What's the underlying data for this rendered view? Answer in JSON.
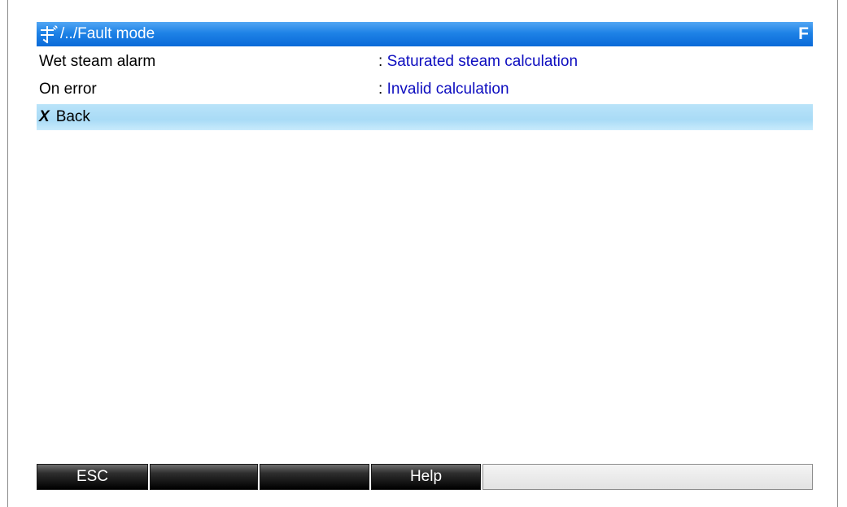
{
  "header": {
    "path": "/../Fault mode",
    "mode": "F",
    "icon": "setup-wrench-icon"
  },
  "rows": [
    {
      "label": "Wet steam alarm",
      "separator": ":",
      "value": "Saturated steam calculation"
    },
    {
      "label": "On error",
      "separator": ":",
      "value": "Invalid calculation"
    }
  ],
  "back": {
    "symbol": "X",
    "label": "Back"
  },
  "softkeys": [
    "ESC",
    "",
    "",
    "Help",
    ""
  ],
  "colors": {
    "title_bar": "#1e82e6",
    "value_text": "#0d0dbf",
    "selected_row": "#a9dbf6"
  }
}
